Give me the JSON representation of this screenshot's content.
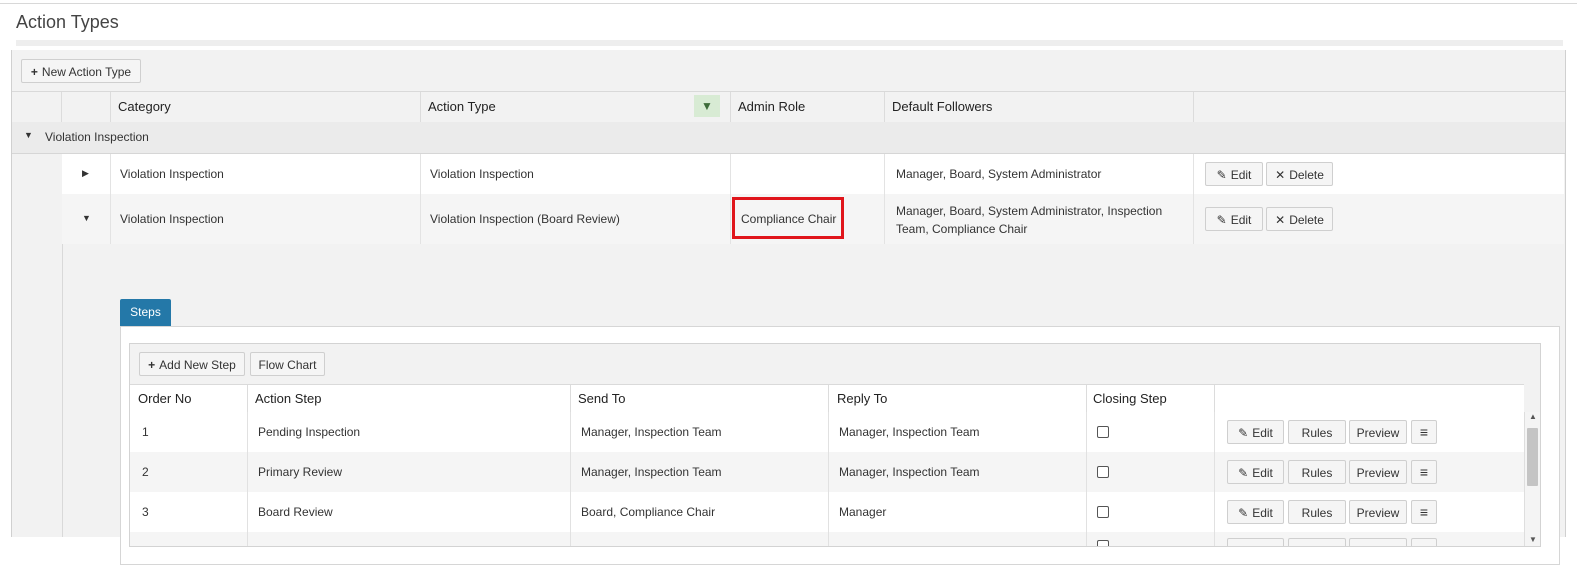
{
  "page": {
    "title": "Action Types"
  },
  "toolbar": {
    "new_action_type": "New Action Type"
  },
  "columns": {
    "category": "Category",
    "action_type": "Action Type",
    "admin_role": "Admin Role",
    "default_followers": "Default Followers"
  },
  "group": {
    "label": "Violation Inspection"
  },
  "rows": [
    {
      "category": "Violation Inspection",
      "action_type": "Violation Inspection",
      "admin_role": "",
      "followers_line1": "Manager, Board, System Administrator",
      "followers_line2": ""
    },
    {
      "category": "Violation Inspection",
      "action_type": "Violation Inspection (Board Review)",
      "admin_role": "Compliance Chair",
      "followers_line1": "Manager, Board, System Administrator, Inspection",
      "followers_line2": "Team, Compliance Chair"
    }
  ],
  "row_actions": {
    "edit": "Edit",
    "delete": "Delete"
  },
  "detail": {
    "tab": "Steps",
    "add_new_step": "Add New Step",
    "flow_chart": "Flow Chart",
    "columns": {
      "order_no": "Order No",
      "action_step": "Action Step",
      "send_to": "Send To",
      "reply_to": "Reply To",
      "closing_step": "Closing Step"
    },
    "steps": [
      {
        "order": "1",
        "step": "Pending Inspection",
        "send_to": "Manager, Inspection Team",
        "reply_to": "Manager, Inspection Team",
        "closing": false
      },
      {
        "order": "2",
        "step": "Primary Review",
        "send_to": "Manager, Inspection Team",
        "reply_to": "Manager, Inspection Team",
        "closing": false
      },
      {
        "order": "3",
        "step": "Board Review",
        "send_to": "Board, Compliance Chair",
        "reply_to": "Manager",
        "closing": false
      }
    ],
    "step_actions": {
      "edit": "Edit",
      "rules": "Rules",
      "preview": "Preview"
    }
  },
  "icons": {
    "plus": "plus-icon",
    "filter": "filter-icon",
    "pencil": "pencil-icon",
    "close": "close-icon",
    "menu": "menu-icon"
  },
  "colors": {
    "tab_active": "#2478a8",
    "highlight": "#e0151b",
    "filter_bg": "#d8ebd4"
  }
}
